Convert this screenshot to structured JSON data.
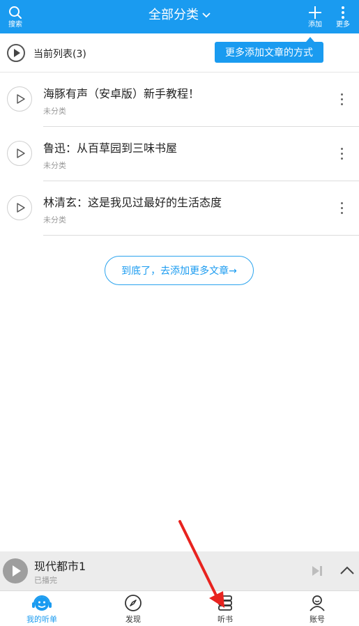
{
  "header": {
    "title": "全部分类",
    "search_label": "搜索",
    "add_label": "添加",
    "more_label": "更多",
    "bg_color": "#1a9bf0"
  },
  "current_list": {
    "label": "当前列表(3)"
  },
  "tooltip": {
    "text": "更多添加文章的方式"
  },
  "items": [
    {
      "title": "海豚有声（安卓版）新手教程！",
      "category": "未分类"
    },
    {
      "title": "鲁迅：从百草园到三味书屋",
      "category": "未分类"
    },
    {
      "title": "林清玄：这是我见过最好的生活态度",
      "category": "未分类"
    }
  ],
  "add_more": {
    "label": "到底了，去添加更多文章→"
  },
  "player": {
    "title": "现代都市1",
    "status": "已播完"
  },
  "tabs": [
    {
      "label": "我的听单",
      "icon": "smiley-headphones-icon",
      "active": true
    },
    {
      "label": "发现",
      "icon": "compass-icon",
      "active": false
    },
    {
      "label": "听书",
      "icon": "book-stack-icon",
      "active": false
    },
    {
      "label": "账号",
      "icon": "user-icon",
      "active": false
    }
  ],
  "colors": {
    "accent": "#1a9bf0",
    "annotation_arrow": "#e8231f"
  }
}
